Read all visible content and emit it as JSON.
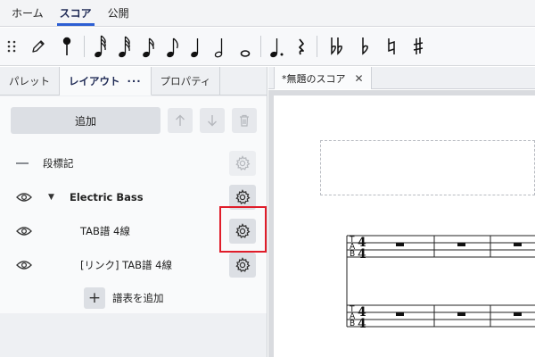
{
  "menu": {
    "items": [
      {
        "label": "ホーム",
        "active": false
      },
      {
        "label": "スコア",
        "active": true
      },
      {
        "label": "公開",
        "active": false
      }
    ]
  },
  "toolbar": {
    "tools": [
      "drag-handle-icon",
      "pencil-icon",
      "pin-icon",
      "64th-note-icon",
      "32nd-note-icon",
      "16th-note-icon",
      "eighth-note-icon",
      "quarter-note-icon",
      "half-note-icon",
      "whole-note-icon",
      "dotted-note-icon",
      "quarter-rest-icon",
      "double-flat-icon",
      "flat-icon",
      "natural-icon",
      "sharp-icon"
    ]
  },
  "panel": {
    "tabs": [
      {
        "label": "パレット",
        "active": false
      },
      {
        "label": "レイアウト",
        "active": true,
        "more": "···"
      },
      {
        "label": "プロパティ",
        "active": false
      }
    ],
    "add_label": "追加",
    "rows": [
      {
        "label": "段標記",
        "indent": "section"
      },
      {
        "label": "Electric Bass",
        "indent": "instrument"
      },
      {
        "label": "TAB譜 4線",
        "indent": "staff"
      },
      {
        "label": "[リンク] TAB譜 4線",
        "indent": "staff"
      }
    ],
    "add_staff_label": "譜表を追加"
  },
  "score": {
    "tab_title": "*無題のスコア",
    "close_glyph": "✕",
    "tab_clef_letters": [
      "T",
      "A",
      "B"
    ],
    "time_signature": "4/4"
  },
  "colors": {
    "accent": "#2d5fd3",
    "highlight": "#e01d2a"
  }
}
